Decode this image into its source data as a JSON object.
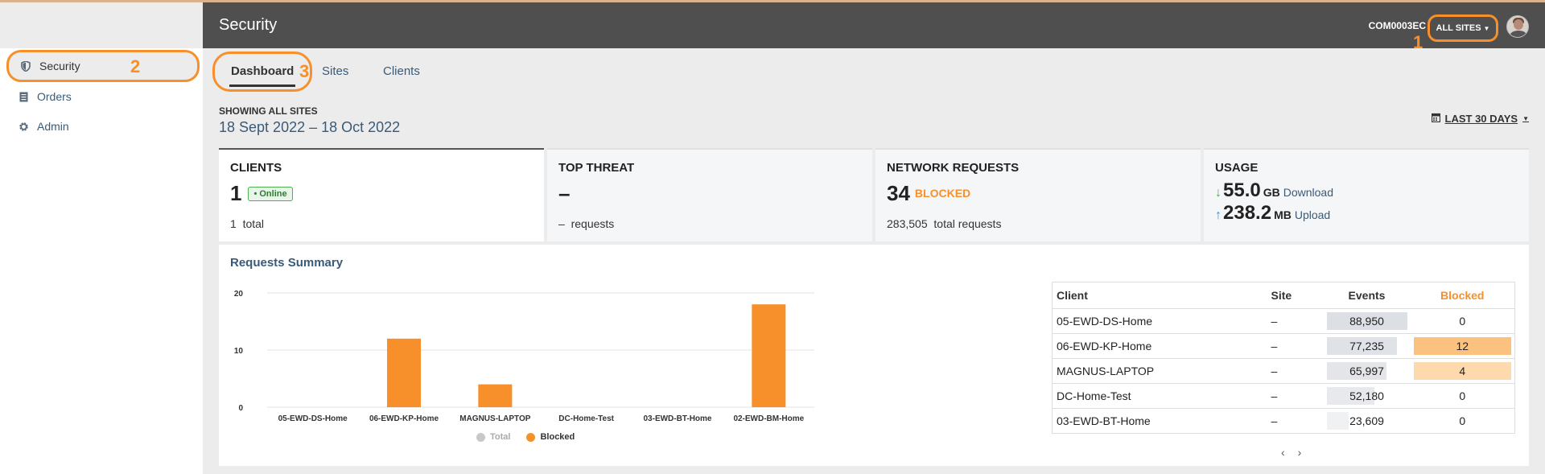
{
  "header": {
    "title": "Security",
    "company": "COM0003EC",
    "site_selector": "ALL SITES",
    "annotation": "1"
  },
  "sidebar": {
    "items": [
      {
        "label": "Security",
        "icon": "shield-icon",
        "active": true
      },
      {
        "label": "Orders",
        "icon": "list-icon",
        "active": false
      },
      {
        "label": "Admin",
        "icon": "gear-icon",
        "active": false
      }
    ],
    "annotation": "2"
  },
  "tabs": {
    "items": [
      "Dashboard",
      "Sites",
      "Clients"
    ],
    "active": "Dashboard",
    "annotation": "3"
  },
  "filter": {
    "showing": "SHOWING ALL SITES",
    "date_range": "18 Sept 2022 – 18 Oct 2022",
    "range_label": "LAST 30 DAYS"
  },
  "cards": {
    "clients": {
      "title": "CLIENTS",
      "value": "1",
      "status": "• Online",
      "sub_value": "1",
      "sub_label": "total"
    },
    "threat": {
      "title": "TOP THREAT",
      "value": "–",
      "sub_value": "–",
      "sub_label": "requests"
    },
    "network": {
      "title": "NETWORK REQUESTS",
      "value": "34",
      "value_label": "BLOCKED",
      "sub_value": "283,505",
      "sub_label": "total requests"
    },
    "usage": {
      "title": "USAGE",
      "download_value": "55.0",
      "download_unit": "GB",
      "download_label": "Download",
      "upload_value": "238.2",
      "upload_unit": "MB",
      "upload_label": "Upload"
    }
  },
  "summary": {
    "title": "Requests Summary",
    "legend": {
      "total": "Total",
      "blocked": "Blocked"
    }
  },
  "chart_data": {
    "type": "bar",
    "title": "Requests Summary",
    "categories": [
      "05-EWD-DS-Home",
      "06-EWD-KP-Home",
      "MAGNUS-LAPTOP",
      "DC-Home-Test",
      "03-EWD-BT-Home",
      "02-EWD-BM-Home"
    ],
    "series": [
      {
        "name": "Total",
        "values": null
      },
      {
        "name": "Blocked",
        "values": [
          0,
          12,
          4,
          0,
          0,
          18
        ]
      }
    ],
    "ylim": [
      0,
      20
    ],
    "yticks": [
      0,
      10,
      20
    ],
    "grid": true,
    "legend": "bottom",
    "colors": {
      "Total": "#c8c8c8",
      "Blocked": "#f7902b"
    }
  },
  "table": {
    "headers": {
      "client": "Client",
      "site": "Site",
      "events": "Events",
      "blocked": "Blocked"
    },
    "rows": [
      {
        "client": "05-EWD-DS-Home",
        "site": "–",
        "events": "88,950",
        "events_value": 88950,
        "blocked": "0",
        "blocked_value": 0
      },
      {
        "client": "06-EWD-KP-Home",
        "site": "–",
        "events": "77,235",
        "events_value": 77235,
        "blocked": "12",
        "blocked_value": 12
      },
      {
        "client": "MAGNUS-LAPTOP",
        "site": "–",
        "events": "65,997",
        "events_value": 65997,
        "blocked": "4",
        "blocked_value": 4
      },
      {
        "client": "DC-Home-Test",
        "site": "–",
        "events": "52,180",
        "events_value": 52180,
        "blocked": "0",
        "blocked_value": 0
      },
      {
        "client": "03-EWD-BT-Home",
        "site": "–",
        "events": "23,609",
        "events_value": 23609,
        "blocked": "0",
        "blocked_value": 0
      }
    ]
  },
  "colors": {
    "accent": "#f7902b",
    "header_bg": "#4f4f4f",
    "link": "#3a5a78",
    "online": "#4caf50"
  }
}
